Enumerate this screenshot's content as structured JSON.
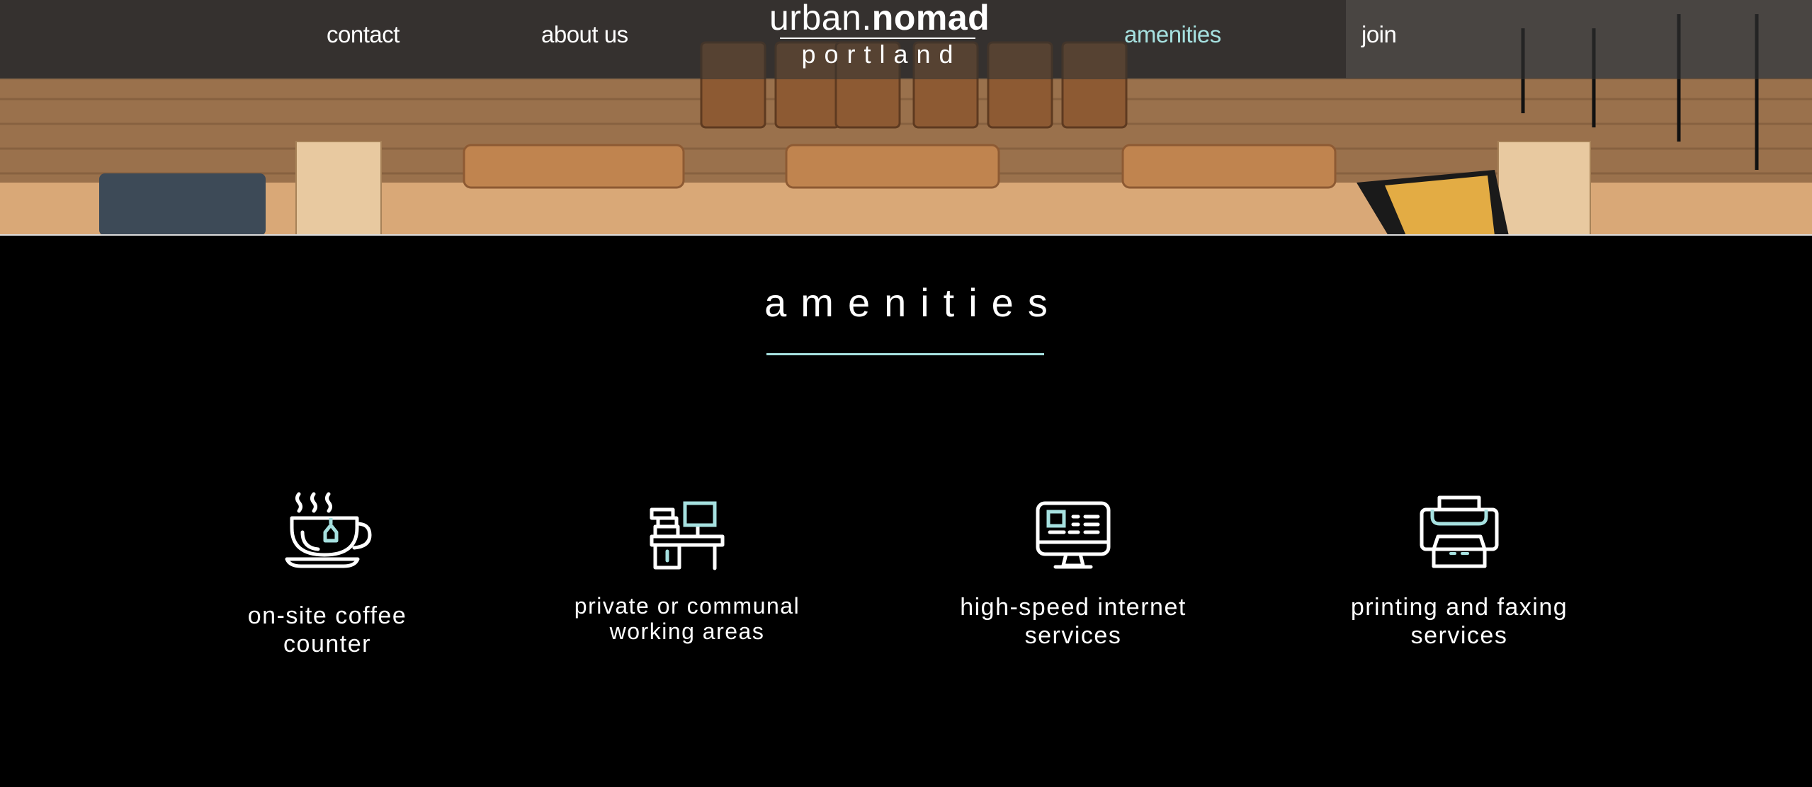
{
  "nav": {
    "links": [
      {
        "label": "contact"
      },
      {
        "label": "about us"
      },
      {
        "label": "amenities",
        "active": true
      },
      {
        "label": "join"
      }
    ],
    "logo": {
      "light": "urban.",
      "bold": "nomad",
      "sub": "portland"
    }
  },
  "section": {
    "title": "amenities",
    "accent_color": "#a6e1e0"
  },
  "amenities": [
    {
      "icon": "coffee-cup-icon",
      "label_line1": "on-site coffee",
      "label_line2": "counter"
    },
    {
      "icon": "desk-workstation-icon",
      "label_line1": "private or communal",
      "label_line2": "working areas"
    },
    {
      "icon": "computer-monitor-icon",
      "label_line1": "high-speed internet",
      "label_line2": "services"
    },
    {
      "icon": "printer-icon",
      "label_line1": "printing and faxing",
      "label_line2": "services"
    }
  ]
}
